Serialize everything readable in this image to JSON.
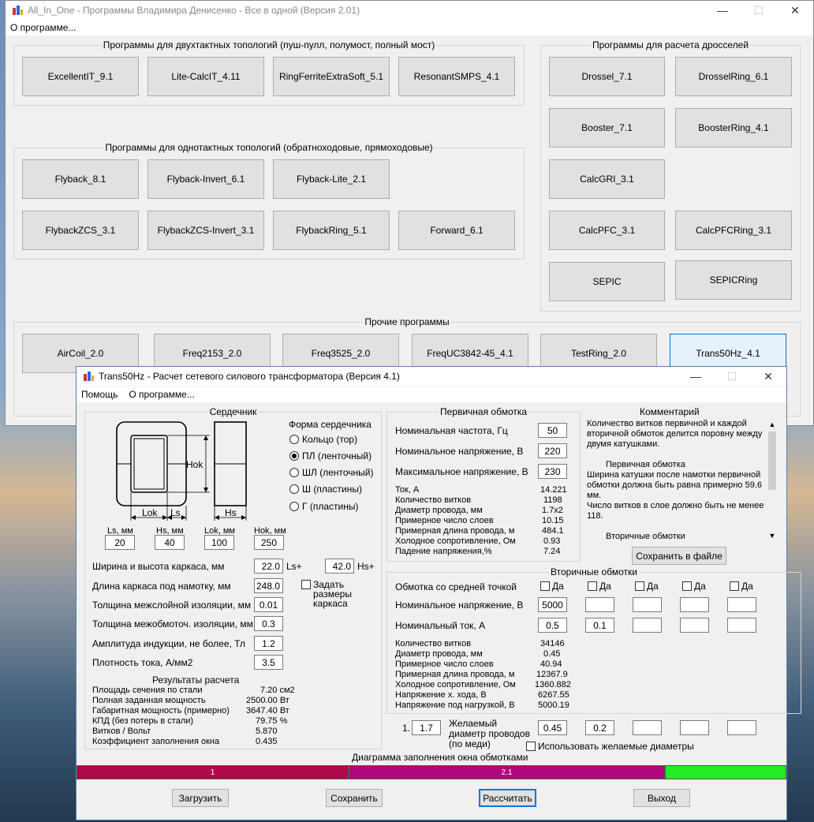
{
  "main": {
    "title": "All_In_One - Программы Владимира Денисенко - Все в одной (Версия 2.01)",
    "menu": [
      "О программе..."
    ],
    "push_pull": {
      "title": "Программы для двухтактных топологий (пуш-пулл, полумост, полный мост)",
      "buttons": [
        "ExcellentIT_9.1",
        "Lite-CalcIT_4.11",
        "RingFerriteExtraSoft_5.1",
        "ResonantSMPS_4.1"
      ]
    },
    "single_ended": {
      "title": "Программы для однотактных топологий (обратноходовые, прямоходовые)",
      "buttons": [
        "Flyback_8.1",
        "Flyback-Invert_6.1",
        "Flyback-Lite_2.1",
        "FlybackZCS_3.1",
        "FlybackZCS-Invert_3.1",
        "FlybackRing_5.1",
        "Forward_6.1"
      ]
    },
    "chokes": {
      "title": "Программы для расчета дросселей",
      "buttons": [
        "Drossel_7.1",
        "DrosselRing_6.1",
        "Booster_7.1",
        "BoosterRing_4.1",
        "CalcGRI_3.1",
        "CalcPFC_3.1",
        "CalcPFCRing_3.1",
        "SEPIC",
        "SEPICRing"
      ]
    },
    "other": {
      "title": "Прочие программы",
      "buttons": [
        "AirCoil_2.0",
        "Freq2153_2.0",
        "Freq3525_2.0",
        "FreqUC3842-45_4.1",
        "TestRing_2.0",
        "Trans50Hz_4.1"
      ]
    }
  },
  "trans": {
    "title": "Trans50Hz - Расчет сетевого силового трансформатора (Версия 4.1)",
    "menu": [
      "Помощь",
      "О программе..."
    ],
    "core": {
      "title": "Сердечник",
      "diagram": {
        "hok": "Hok",
        "lok": "Lok",
        "ls": "Ls",
        "hs": "Hs"
      },
      "dims": [
        {
          "label": "Ls, мм",
          "value": "20"
        },
        {
          "label": "Hs, мм",
          "value": "40"
        },
        {
          "label": "Lok, мм",
          "value": "100"
        },
        {
          "label": "Hok, мм",
          "value": "250"
        }
      ],
      "shape_title": "Форма сердечника",
      "shapes": [
        {
          "label": "Кольцо  (тор)",
          "checked": false
        },
        {
          "label": "ПЛ  (ленточный)",
          "checked": true
        },
        {
          "label": "ШЛ  (ленточный)",
          "checked": false
        },
        {
          "label": "Ш  (пластины)",
          "checked": false
        },
        {
          "label": "Г (пластины)",
          "checked": false
        }
      ]
    },
    "params": {
      "frame_wh_label": "Ширина и высота каркаса, мм",
      "frame_w": "22.0",
      "ls_plus": "Ls+",
      "frame_h": "42.0",
      "hs_plus": "Hs+",
      "frame_len_label": "Длина каркаса под намотку, мм",
      "frame_len": "248.0",
      "set_frame_label": "Задать размеры каркаса",
      "interlayer_label": "Толщина межслойной изоляции, мм",
      "interlayer": "0.01",
      "interwinding_label": "Толщина межобмоточ. изоляции, мм",
      "interwinding": "0.3",
      "induction_label": "Амплитуда индукции, не более, Тл",
      "induction": "1.2",
      "density_label": "Плотность тока, А/мм2",
      "density": "3.5"
    },
    "results": {
      "title": "Результаты расчета",
      "rows": [
        {
          "label": "Площадь сечения по стали",
          "value": "7.20 см2"
        },
        {
          "label": "Полная заданная мощность",
          "value": "2500.00 Вт"
        },
        {
          "label": "Габаритная мощность (примерно)",
          "value": "3647.40 Вт"
        },
        {
          "label": "КПД (без потерь в стали)",
          "value": "79.75 %"
        },
        {
          "label": "Витков / Вольт",
          "value": "5.870"
        },
        {
          "label": "Коэффициент заполнения окна",
          "value": "0.435"
        }
      ]
    },
    "primary": {
      "title": "Первичная обмотка",
      "freq_label": "Номинальная частота, Гц",
      "freq": "50",
      "volt_label": "Номинальное напряжение, В",
      "volt": "220",
      "vmax_label": "Максимальное напряжение, В",
      "vmax": "230",
      "rows": [
        {
          "label": "Ток, А",
          "value": "14.221"
        },
        {
          "label": "Количество витков",
          "value": "1198"
        },
        {
          "label": "Диаметр провода, мм",
          "value": "1.7x2"
        },
        {
          "label": "Примерное число слоев",
          "value": "10.15"
        },
        {
          "label": "Примерная длина провода, м",
          "value": "484.1"
        },
        {
          "label": "Холодное сопротивление, Ом",
          "value": "0.93"
        },
        {
          "label": "Падение напряжения,%",
          "value": "7.24"
        }
      ]
    },
    "comment": {
      "title": "Комментарий",
      "p1": "Количество витков первичной и каждой вторичной обмоток делится поровну между двумя катушками.",
      "h2": "Первичная обмотка",
      "p2": "Ширина катушки после намотки первичной обмотки должна быть равна примерно 59.6 мм.",
      "p3": "Число витков в слое должно быть не менее 118.",
      "h3": "Вторичные обмотки",
      "save_btn": "Сохранить в файле"
    },
    "secondary": {
      "title": "Вторичные обмотки",
      "center_tap_label": "Обмотка со средней точкой",
      "checkbox_label": "Да",
      "volt_label": "Номинальное напряжение, В",
      "volts": [
        "5000",
        "",
        "",
        "",
        ""
      ],
      "current_label": "Номинальный ток, А",
      "currents": [
        "0.5",
        "0.1",
        "",
        "",
        ""
      ],
      "rows": [
        {
          "label": "Количество витков",
          "value": "34146"
        },
        {
          "label": "Диаметр провода, мм",
          "value": "0.45"
        },
        {
          "label": "Примерное число слоев",
          "value": "40.94"
        },
        {
          "label": "Примерная длина провода, м",
          "value": "12367.9"
        },
        {
          "label": "Холодное сопротивление, Ом",
          "value": "1360.882"
        },
        {
          "label": "Напряжение х. хода, В",
          "value": "6267.55"
        },
        {
          "label": "Напряжение под нагрузкой, В",
          "value": "5000.19"
        }
      ]
    },
    "desired": {
      "prefix": "1.",
      "primary": "1.7",
      "label": "Желаемый диаметр проводов  (по меди)",
      "values": [
        "0.45",
        "0.2",
        "",
        "",
        ""
      ],
      "use_label": "Использовать желаемые диаметры"
    },
    "fill_diagram": {
      "title": "Диаграмма заполнения окна обмотками",
      "segments": [
        {
          "label": "1",
          "color": "#b0084a"
        },
        {
          "label": "2.1",
          "color": "#b0087a"
        },
        {
          "label": "",
          "color": "#22ee22"
        }
      ]
    },
    "buttons": {
      "load": "Загрузить",
      "save": "Сохранить",
      "calc": "Рассчитать",
      "exit": "Выход"
    }
  }
}
